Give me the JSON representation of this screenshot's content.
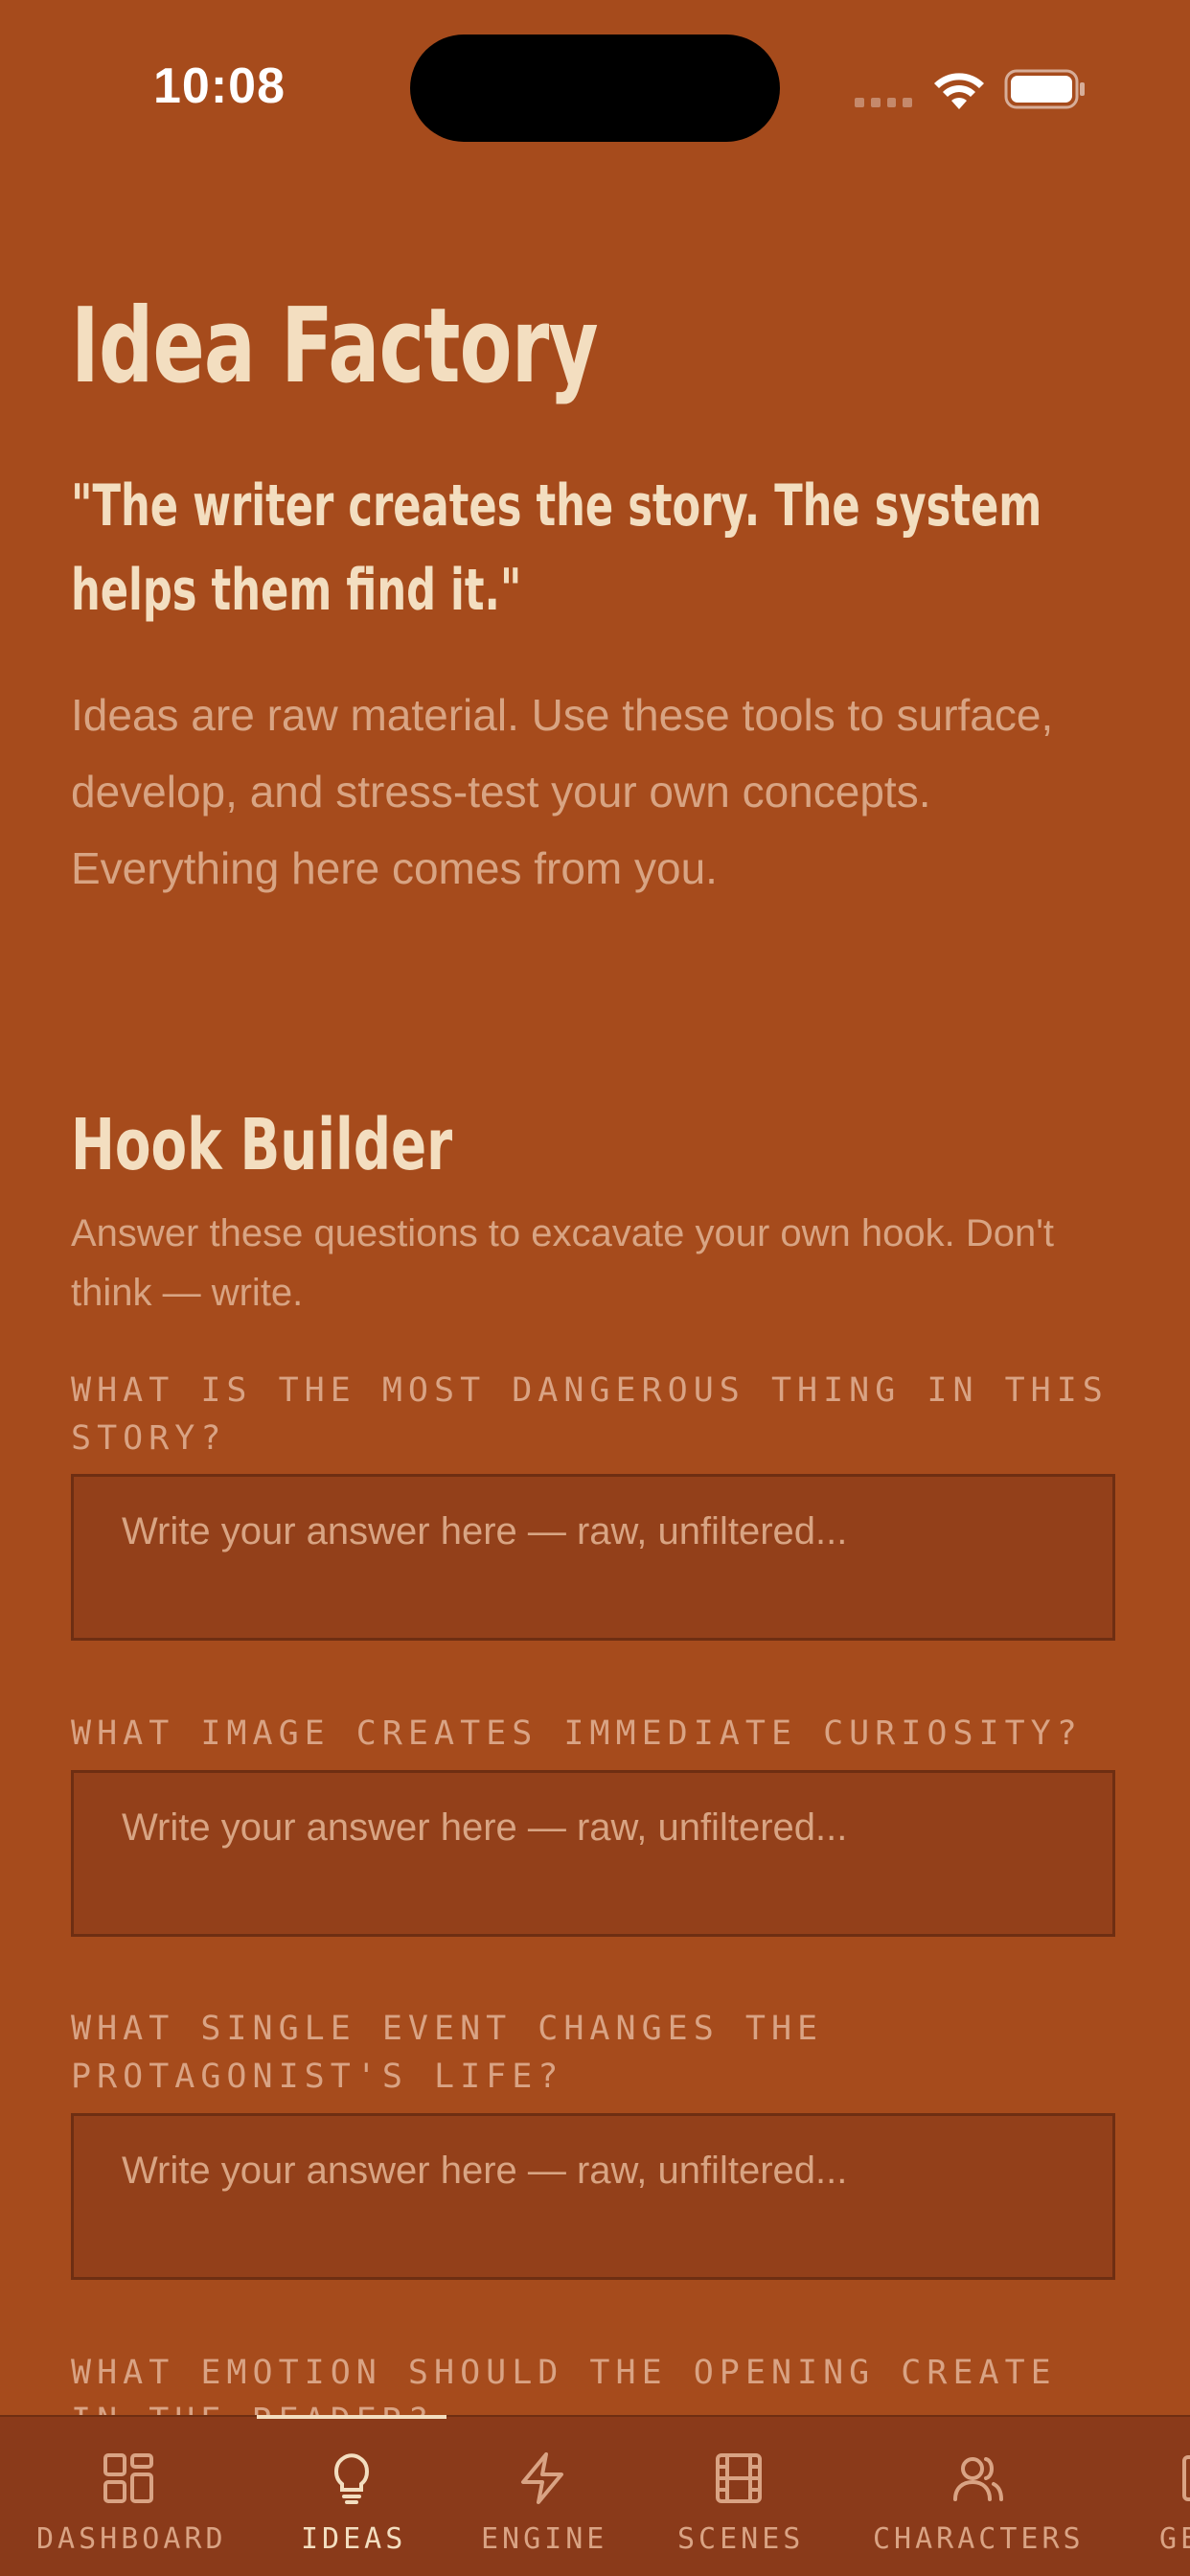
{
  "status_bar": {
    "time": "10:08"
  },
  "page": {
    "title": "Idea Factory",
    "quote": "\"The writer creates the story. The system helps them find it.\"",
    "intro": "Ideas are raw material. Use these tools to surface, develop, and stress-test your own concepts. Everything here comes from you."
  },
  "hook_builder": {
    "title": "Hook Builder",
    "description": "Answer these questions to excavate your own hook. Don't think — write.",
    "questions": [
      {
        "label": "What is the most dangerous thing in this story?",
        "placeholder": "Write your answer here — raw, unfiltered..."
      },
      {
        "label": "What image creates immediate curiosity?",
        "placeholder": "Write your answer here — raw, unfiltered..."
      },
      {
        "label": "What single event changes the protagonist's life?",
        "placeholder": "Write your answer here — raw, unfiltered..."
      },
      {
        "label": "What emotion should the opening create in the reader?"
      }
    ]
  },
  "tab_bar": {
    "active": "ideas",
    "tabs": [
      {
        "id": "dashboard",
        "label": "DASHBOARD",
        "icon": "dashboard-grid-icon"
      },
      {
        "id": "ideas",
        "label": "IDEAS",
        "icon": "lightbulb-icon"
      },
      {
        "id": "engine",
        "label": "ENGINE",
        "icon": "lightning-bolt-icon"
      },
      {
        "id": "scenes",
        "label": "SCENES",
        "icon": "film-strip-icon"
      },
      {
        "id": "characters",
        "label": "CHARACTERS",
        "icon": "users-icon"
      },
      {
        "id": "partial",
        "label": "GE",
        "icon": "partial-icon"
      }
    ]
  },
  "colors": {
    "background": "#A64B1C",
    "tab_bar": "#8A3A1A",
    "input_fill": "#93401A",
    "heading": "#F3DEC0",
    "muted": "#D8A483"
  }
}
